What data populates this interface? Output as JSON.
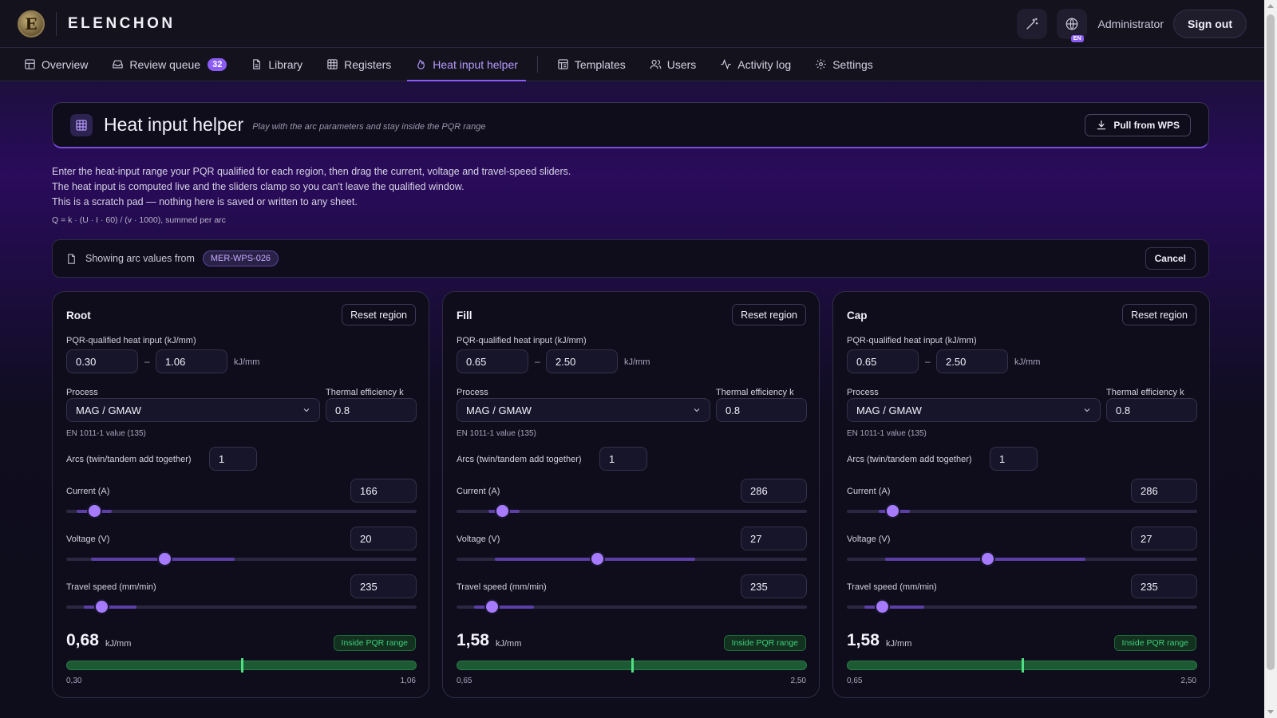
{
  "app": {
    "brand": "ELENCHON",
    "logo_letter": "E",
    "user": "Administrator",
    "sign_out": "Sign out",
    "lang_badge": "EN"
  },
  "nav": {
    "items": [
      {
        "label": "Overview",
        "icon": "grid-icon"
      },
      {
        "label": "Review queue",
        "icon": "inbox-icon",
        "badge": "32"
      },
      {
        "label": "Library",
        "icon": "document-icon"
      },
      {
        "label": "Registers",
        "icon": "table-icon"
      },
      {
        "label": "Heat input helper",
        "icon": "flame-icon",
        "active": true
      },
      {
        "label": "Templates",
        "icon": "template-icon"
      },
      {
        "label": "Users",
        "icon": "users-icon"
      },
      {
        "label": "Activity log",
        "icon": "activity-icon"
      },
      {
        "label": "Settings",
        "icon": "gear-icon"
      }
    ]
  },
  "header": {
    "title": "Heat input helper",
    "subtitle": "Play with the arc parameters and stay inside the PQR range",
    "pull_button": "Pull from WPS"
  },
  "description": {
    "line1": "Enter the heat-input range your PQR qualified for each region, then drag the current, voltage and travel-speed sliders.",
    "line2": "The heat input is computed live and the sliders clamp so you can't leave the qualified window.",
    "line3": "This is a scratch pad — nothing here is saved or written to any sheet.",
    "formula": "Q = k · (U · I · 60) / (v · 1000), summed per arc"
  },
  "source": {
    "label": "Showing arc values from",
    "wps": "MER-WPS-026",
    "cancel": "Cancel"
  },
  "labels": {
    "reset": "Reset region",
    "pqr_label": "PQR-qualified heat input (kJ/mm)",
    "dash": "–",
    "kjmm": "kJ/mm",
    "process": "Process",
    "thermal": "Thermal efficiency k",
    "en_value": "EN 1011-1 value (135)",
    "arcs": "Arcs (twin/tandem add together)",
    "current": "Current (A)",
    "voltage": "Voltage (V)",
    "travel": "Travel speed (mm/min)"
  },
  "regions": [
    {
      "name": "Root",
      "pqr_min": "0.30",
      "pqr_max": "1.06",
      "process": "MAG / GMAW",
      "k": "0.8",
      "arcs": "1",
      "current": "166",
      "voltage": "20",
      "travel": "235",
      "current_slider": {
        "fill": 0.08,
        "range": [
          0.03,
          0.13
        ]
      },
      "voltage_slider": {
        "fill": 0.28,
        "range": [
          0.07,
          0.48
        ]
      },
      "travel_slider": {
        "fill": 0.1,
        "range": [
          0.05,
          0.2
        ]
      },
      "heat_input": "0,68",
      "status": "Inside PQR range",
      "gauge_fill": 0.5,
      "gauge_min": "0,30",
      "gauge_max": "1,06"
    },
    {
      "name": "Fill",
      "pqr_min": "0.65",
      "pqr_max": "2.50",
      "process": "MAG / GMAW",
      "k": "0.8",
      "arcs": "1",
      "current": "286",
      "voltage": "27",
      "travel": "235",
      "current_slider": {
        "fill": 0.13,
        "range": [
          0.09,
          0.18
        ]
      },
      "voltage_slider": {
        "fill": 0.4,
        "range": [
          0.11,
          0.68
        ]
      },
      "travel_slider": {
        "fill": 0.1,
        "range": [
          0.05,
          0.22
        ]
      },
      "heat_input": "1,58",
      "status": "Inside PQR range",
      "gauge_fill": 0.5,
      "gauge_min": "0,65",
      "gauge_max": "2,50"
    },
    {
      "name": "Cap",
      "pqr_min": "0.65",
      "pqr_max": "2.50",
      "process": "MAG / GMAW",
      "k": "0.8",
      "arcs": "1",
      "current": "286",
      "voltage": "27",
      "travel": "235",
      "current_slider": {
        "fill": 0.13,
        "range": [
          0.09,
          0.18
        ]
      },
      "voltage_slider": {
        "fill": 0.4,
        "range": [
          0.11,
          0.68
        ]
      },
      "travel_slider": {
        "fill": 0.1,
        "range": [
          0.05,
          0.22
        ]
      },
      "heat_input": "1,58",
      "status": "Inside PQR range",
      "gauge_fill": 0.5,
      "gauge_min": "0,65",
      "gauge_max": "2,50"
    }
  ],
  "colors": {
    "accent": "#8b5cf6",
    "success": "#3fd07a",
    "background": "#0f0d1b"
  }
}
